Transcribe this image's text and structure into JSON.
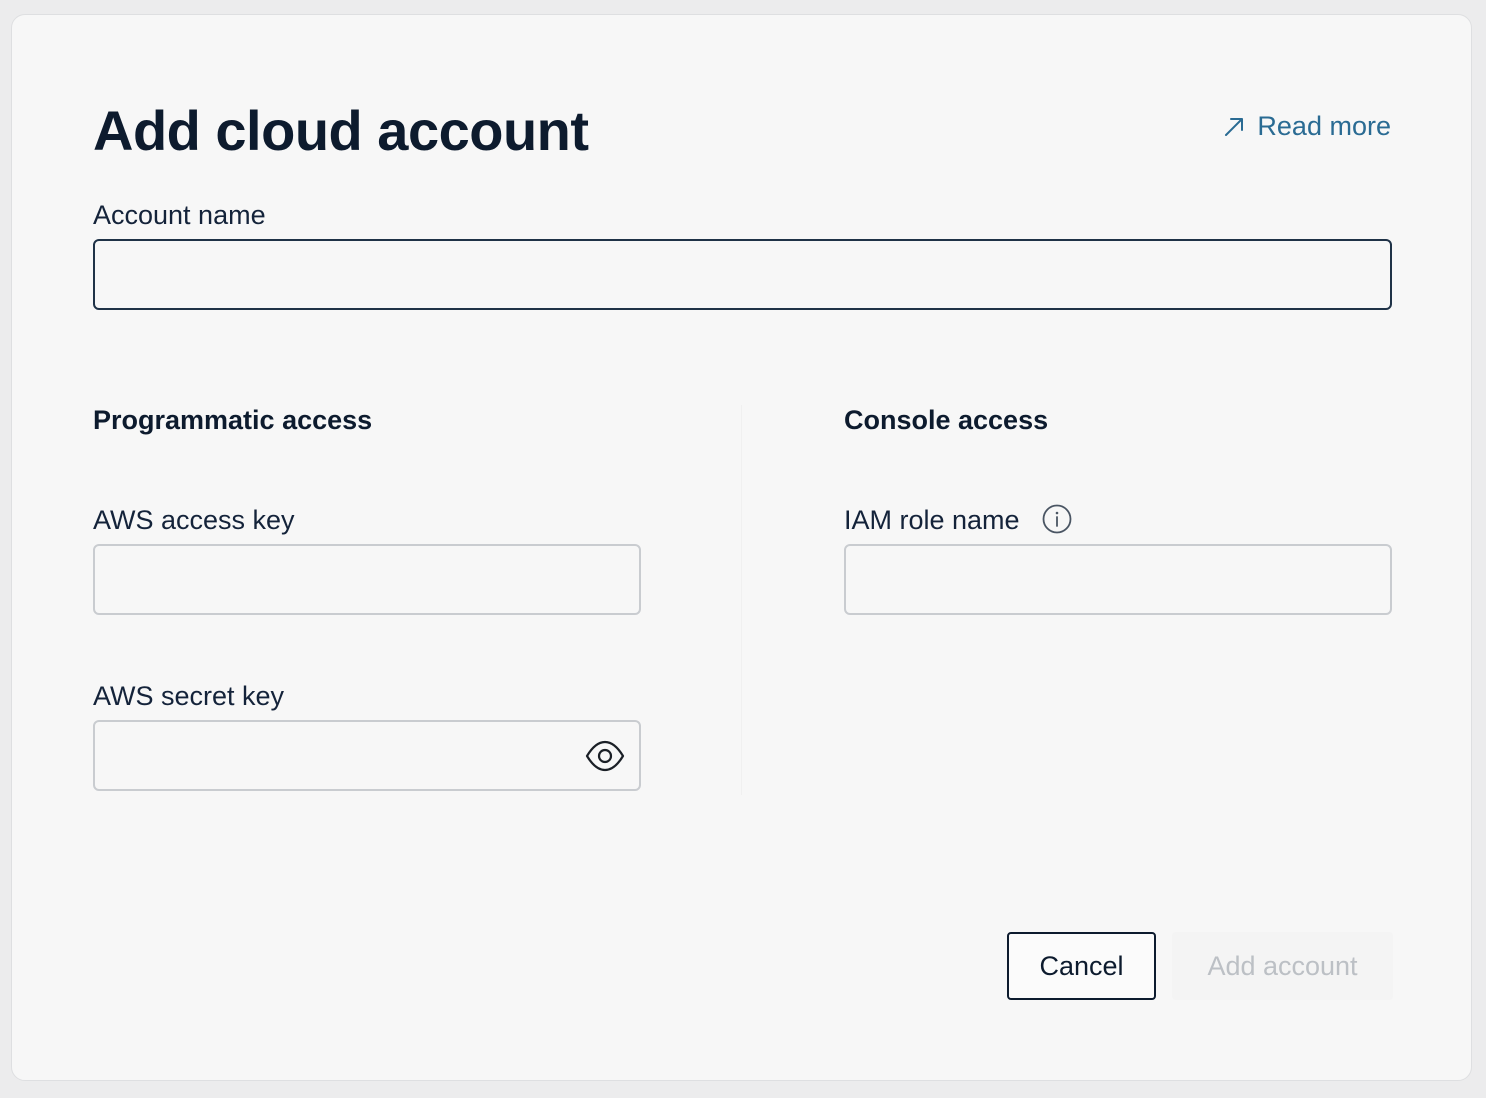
{
  "dialog": {
    "title": "Add cloud account",
    "read_more": "Read more",
    "account_name": {
      "label": "Account name",
      "value": ""
    },
    "programmatic": {
      "title": "Programmatic access",
      "access_key": {
        "label": "AWS access key",
        "value": ""
      },
      "secret_key": {
        "label": "AWS secret key",
        "value": ""
      }
    },
    "console": {
      "title": "Console access",
      "iam_role": {
        "label": "IAM role name",
        "value": ""
      }
    },
    "buttons": {
      "cancel": "Cancel",
      "add": "Add account"
    },
    "icons": {
      "read_more": "external-link-arrow-icon",
      "iam_info": "info-icon",
      "secret_toggle": "eye-icon"
    },
    "colors": {
      "link": "#2a6b93",
      "text": "#0d1b2e",
      "disabled_text": "#bcc0c5"
    }
  }
}
